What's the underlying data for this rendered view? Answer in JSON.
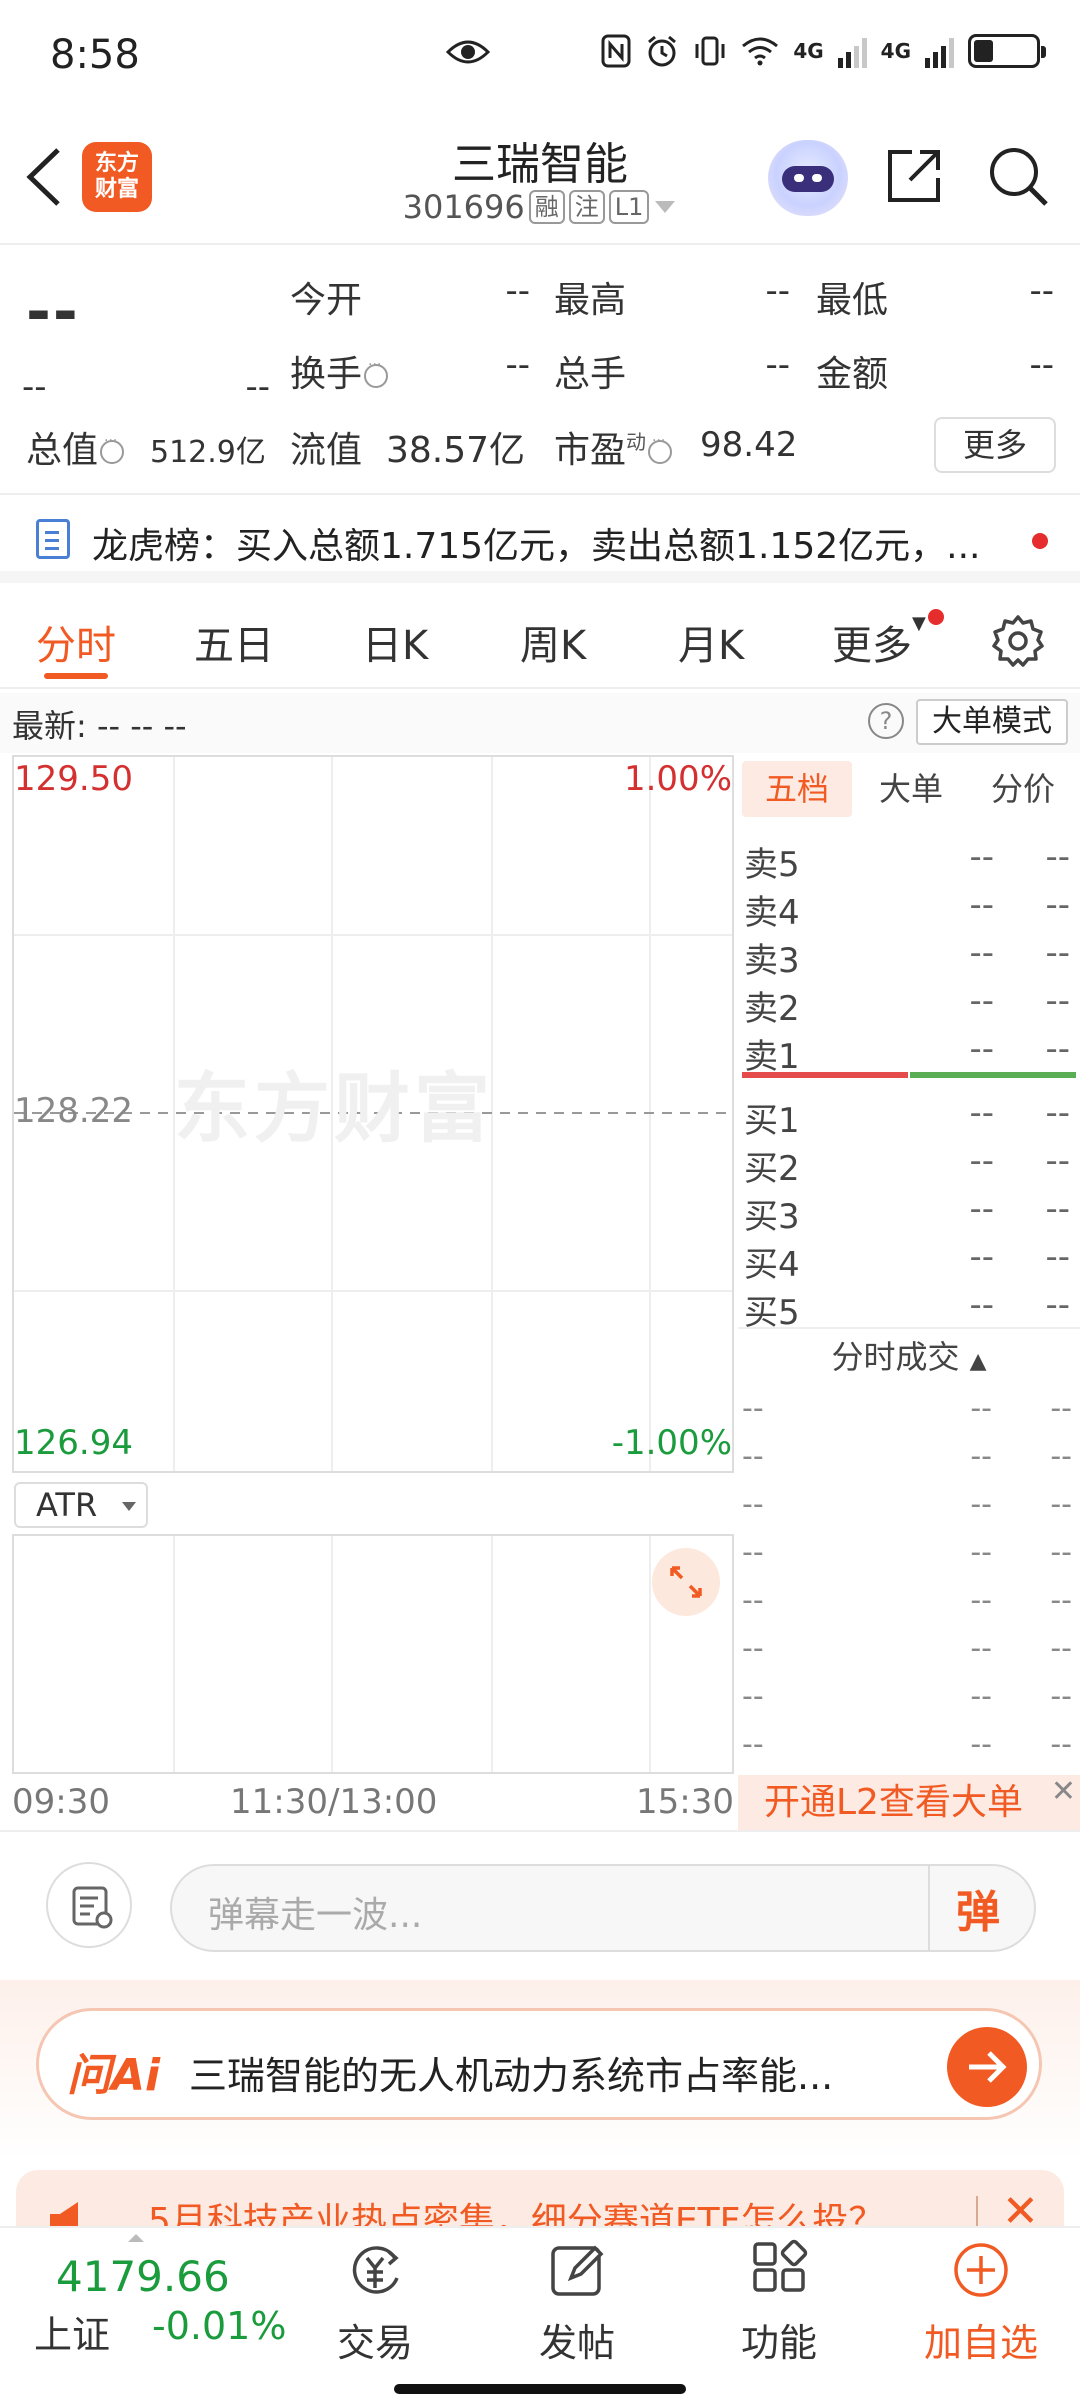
{
  "status_bar": {
    "time": "8:58",
    "network_1": "4G",
    "network_2": "4G"
  },
  "header": {
    "title": "三瑞智能",
    "code": "301696",
    "tags": [
      "融",
      "注",
      "L1"
    ],
    "logo_line1": "东方",
    "logo_line2": "财富"
  },
  "quote": {
    "price": "--",
    "change": "--",
    "change_pct": "--",
    "open_label": "今开",
    "open_value": "--",
    "high_label": "最高",
    "high_value": "--",
    "low_label": "最低",
    "low_value": "--",
    "turnover_label": "换手",
    "turnover_value": "--",
    "volume_label": "总手",
    "volume_value": "--",
    "amount_label": "金额",
    "amount_value": "--",
    "mktcap_label": "总值",
    "mktcap_value": "512.9亿",
    "float_label": "流值",
    "float_value": "38.57亿",
    "pe_label": "市盈",
    "pe_sup": "动",
    "pe_value": "98.42",
    "more_label": "更多"
  },
  "dragon_board": {
    "text": "龙虎榜：买入总额1.715亿元，卖出总额1.152亿元，..."
  },
  "tabs": {
    "items": [
      "分时",
      "五日",
      "日K",
      "周K",
      "月K",
      "更多"
    ],
    "active": 0
  },
  "latest_row": {
    "text": "最新:  --  --  --",
    "help": "?",
    "big_order_mode": "大单模式"
  },
  "chart": {
    "watermark": "东方财富",
    "top_price": "129.50",
    "top_pct": "1.00%",
    "mid_price": "128.22",
    "bottom_price": "126.94",
    "bottom_pct": "-1.00%",
    "indicator": "ATR",
    "time_start": "09:30",
    "time_mid": "11:30/13:00",
    "time_end": "15:30",
    "colors": {
      "up": "#d43030",
      "down": "#1a9b3c",
      "accent": "#f15a22"
    }
  },
  "order_book": {
    "tabs": [
      "五档",
      "大单",
      "分价"
    ],
    "sell": [
      {
        "label": "卖5",
        "price": "--",
        "vol": "--"
      },
      {
        "label": "卖4",
        "price": "--",
        "vol": "--"
      },
      {
        "label": "卖3",
        "price": "--",
        "vol": "--"
      },
      {
        "label": "卖2",
        "price": "--",
        "vol": "--"
      },
      {
        "label": "卖1",
        "price": "--",
        "vol": "--"
      }
    ],
    "buy": [
      {
        "label": "买1",
        "price": "--",
        "vol": "--"
      },
      {
        "label": "买2",
        "price": "--",
        "vol": "--"
      },
      {
        "label": "买3",
        "price": "--",
        "vol": "--"
      },
      {
        "label": "买4",
        "price": "--",
        "vol": "--"
      },
      {
        "label": "买5",
        "price": "--",
        "vol": "--"
      }
    ],
    "ticks_header": "分时成交",
    "ticks": [
      [
        "--",
        "--",
        "--"
      ],
      [
        "--",
        "--",
        "--"
      ],
      [
        "--",
        "--",
        "--"
      ],
      [
        "--",
        "--",
        "--"
      ],
      [
        "--",
        "--",
        "--"
      ],
      [
        "--",
        "--",
        "--"
      ],
      [
        "--",
        "--",
        "--"
      ],
      [
        "--",
        "--",
        "--"
      ]
    ],
    "l2_banner": "开通L2查看大单",
    "l2_close": "✕"
  },
  "danmaku": {
    "placeholder": "弹幕走一波...",
    "send_label": "弹"
  },
  "ai_banner": {
    "logo": "问Ai",
    "text": "三瑞智能的无人机动力系统市占率能..."
  },
  "hot_strip": {
    "text": "5月科技产业热点密集，细分赛道ETF怎么投？",
    "close": "✕"
  },
  "bottom_nav": {
    "index_value": "4179.66",
    "index_name": "上证",
    "index_change": "-0.01%",
    "items": [
      "交易",
      "发帖",
      "功能",
      "加自选"
    ]
  }
}
